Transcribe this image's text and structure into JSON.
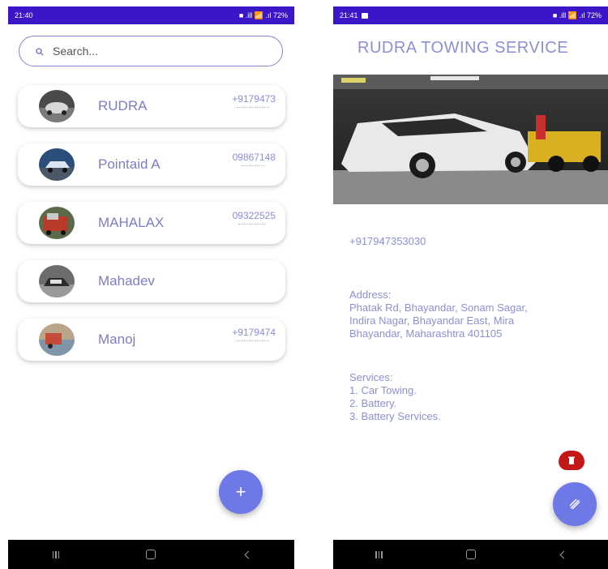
{
  "left": {
    "status": {
      "time": "21:40",
      "right": "■ .ill 📶 .ıl 72%"
    },
    "search": {
      "placeholder": "Search..."
    },
    "contacts": [
      {
        "name": "RUDRA",
        "phone": "+9179473"
      },
      {
        "name": "Pointaid A",
        "phone": "09867148"
      },
      {
        "name": "MAHALAX",
        "phone": "09322525"
      },
      {
        "name": "Mahadev",
        "phone": ""
      },
      {
        "name": "Manoj",
        "phone": "+9179474"
      }
    ],
    "fab_label": "+"
  },
  "right": {
    "status": {
      "time": "21:41",
      "right": "■ .ill 📶 .ıl 72%"
    },
    "title": "RUDRA TOWING SERVICE",
    "phone": "+917947353030",
    "address": {
      "label": "Address:",
      "lines": [
        "Phatak Rd, Bhayandar, Sonam Sagar,",
        "Indira Nagar, Bhayandar East, Mira",
        "Bhayandar, Maharashtra 401105"
      ]
    },
    "services": {
      "label": "Services:",
      "items": [
        "1. Car Towing.",
        "2. Battery.",
        "3. Battery Services."
      ]
    }
  },
  "colors": {
    "status_bar": "#3a16c8",
    "accent": "#6e78e6",
    "text": "#7a7ec9",
    "delete": "#c41818"
  }
}
